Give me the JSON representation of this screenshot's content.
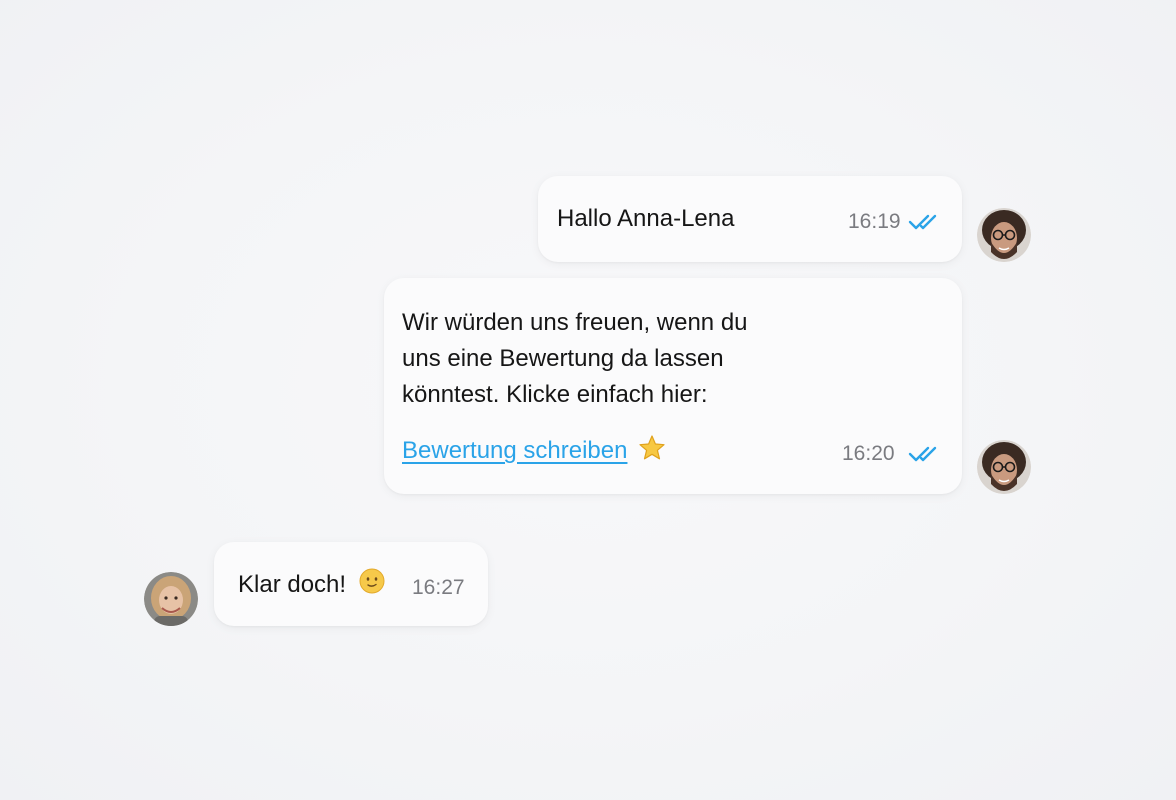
{
  "messages": [
    {
      "direction": "outgoing",
      "text": "Hallo Anna-Lena",
      "time": "16:19",
      "status": "double-check-read"
    },
    {
      "direction": "outgoing",
      "lines": [
        "Wir würden uns freuen, wenn du",
        "uns eine Bewertung da lassen",
        "könntest. Klicke einfach hier:"
      ],
      "link_text": "Bewertung schreiben",
      "link_icon": "star-emoji",
      "time": "16:20",
      "status": "double-check-read"
    },
    {
      "direction": "incoming",
      "text": "Klar doch!",
      "emoji": "smiling-face-emoji",
      "time": "16:27"
    }
  ],
  "colors": {
    "link": "#2aa3e8",
    "read_ticks": "#2aa3e8",
    "timestamp": "#7a7b80",
    "bubble": "#fbfbfc"
  }
}
